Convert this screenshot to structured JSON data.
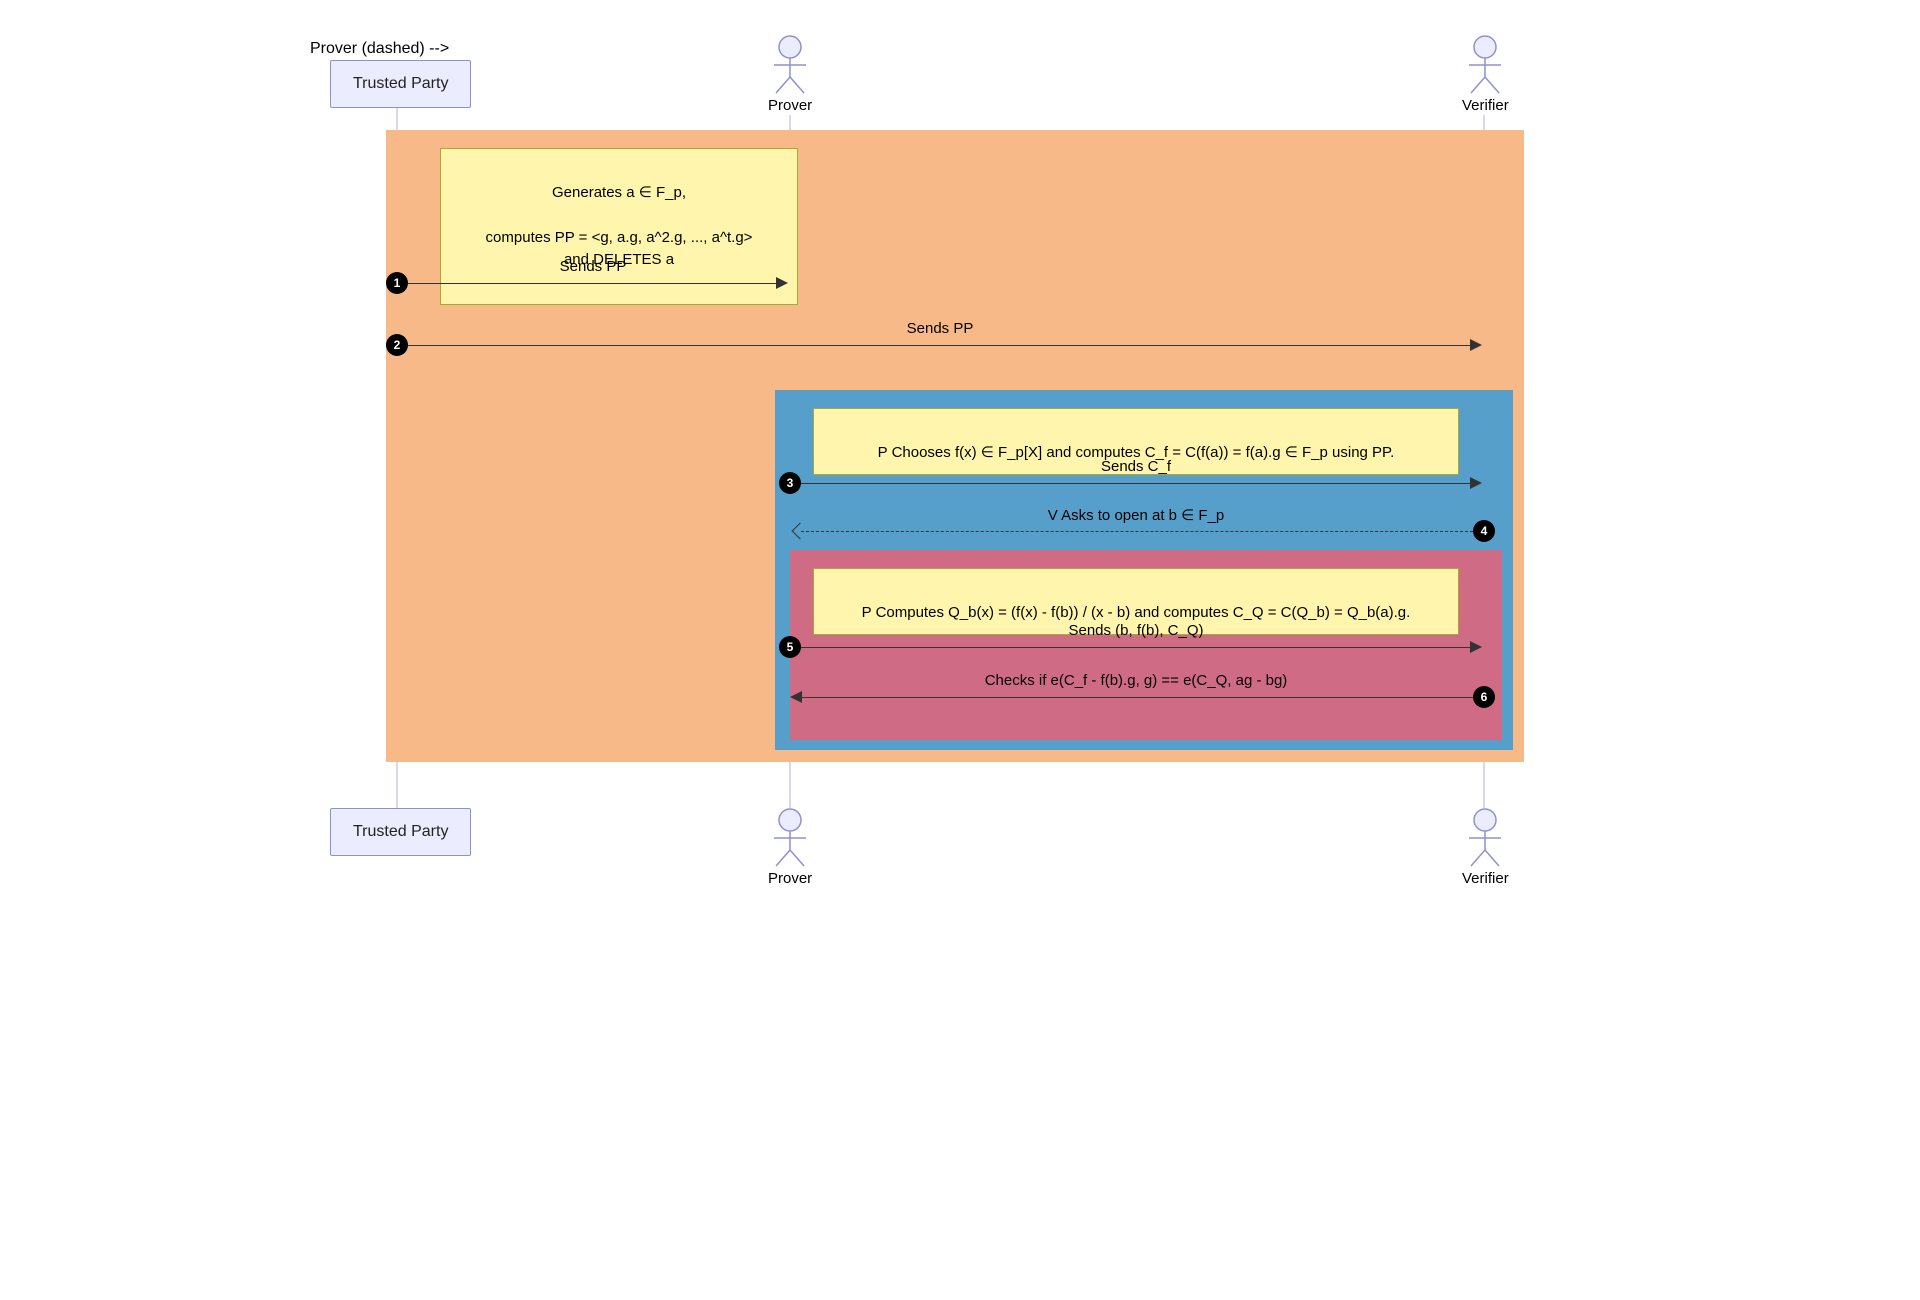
{
  "participants": {
    "trusted": "Trusted Party",
    "prover": "Prover",
    "verifier": "Verifier"
  },
  "notes": {
    "n1_line1": "Generates a ∈ F_p,",
    "n1_line2": "computes PP = <g, a.g, a^2.g, ..., a^t.g>\nand DELETES a",
    "n2": "P Chooses f(x) ∈ F_p[X] and computes C_f = C(f(a)) = f(a).g ∈ F_p using PP.",
    "n3": "P Computes Q_b(x) = (f(x) - f(b)) / (x - b) and computes C_Q = C(Q_b) = Q_b(a).g."
  },
  "messages": {
    "m1": "Sends PP",
    "m2": "Sends PP",
    "m3": "Sends C_f",
    "m4": "V Asks to open at b ∈ F_p",
    "m5": "Sends (b, f(b), C_Q)",
    "m6": "Checks if e(C_f - f(b).g, g) == e(C_Q, ag - bg)"
  },
  "seq": {
    "s1": "1",
    "s2": "2",
    "s3": "3",
    "s4": "4",
    "s5": "5",
    "s6": "6"
  }
}
